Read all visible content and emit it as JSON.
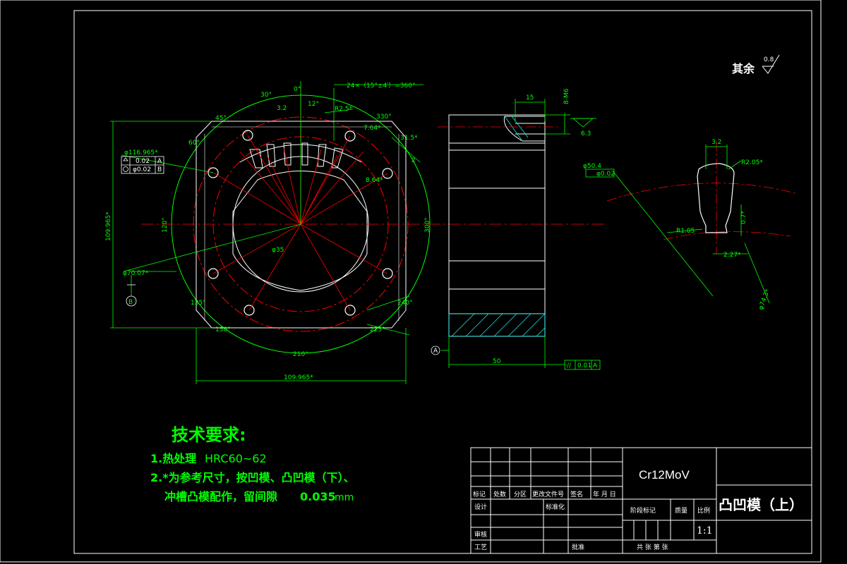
{
  "surface_note": {
    "label": "其余",
    "value": "0.8"
  },
  "tech_requirements": {
    "title": "技术要求:",
    "item1_prefix": "1.热处理",
    "item1_value": "HRC60~62",
    "item2_line1": "2.*为参考尺寸，按凹模、凸凹模（下）、",
    "item2_line2_prefix": "冲槽凸模配作，留间隙",
    "item2_line2_value": "0.035",
    "item2_line2_unit": "mm"
  },
  "title_block": {
    "material": "Cr12MoV",
    "part_name": "凸凹模（上）",
    "scale": "1:1",
    "headers": [
      "标记",
      "处数",
      "分区",
      "更改文件号",
      "签名",
      "年 月 日"
    ],
    "design": "设计",
    "standardize": "标准化",
    "stage_mark": "阶段标记",
    "weight": "质量",
    "ratio": "比例",
    "review": "审核",
    "process": "工艺",
    "approve": "批准",
    "sheets": "共   张   第   张"
  },
  "front_view": {
    "dims": {
      "chamfer_note": "24×（15°±4′）=360°",
      "dia_top": "φ116.965*",
      "tol1": "0.02",
      "datum_a": "A",
      "tol2": "φ0.02",
      "datum_b": "B",
      "dia_circle": "φ70.07*",
      "datum_label": "B",
      "height": "109.965*",
      "width": "109.965*",
      "angle_0": "0°",
      "angle_30": "30°",
      "angle_45": "45°",
      "angle_60": "60°",
      "angle_120": "120°",
      "angle_12": "12°",
      "angle_330": "330°",
      "angle_300": "300°",
      "angle_240": "240°",
      "angle_225": "225°",
      "angle_210": "210°",
      "angle_150": "150°",
      "angle_135": "135°",
      "r25": "R2.5*",
      "d76": "7.64*",
      "d315": "31.5*",
      "d864": "8.64*",
      "d35": "φ35",
      "rough32": "3.2",
      "dim_2": "2"
    }
  },
  "side_view": {
    "dims": {
      "w15": "15",
      "m6": "8-M6",
      "rough63": "6.3",
      "w50": "50",
      "datum_a": "A",
      "par_tol": "0.01",
      "par_datum": "A",
      "pos_tol": "φ50.4",
      "pos_val": "φ0.02"
    }
  },
  "detail_view": {
    "dims": {
      "w32": "3.2",
      "r205": "R2.05*",
      "d07": "0.7*",
      "r105": "R1.05",
      "d227": "2.27*",
      "d743": "φ74.3*"
    }
  }
}
